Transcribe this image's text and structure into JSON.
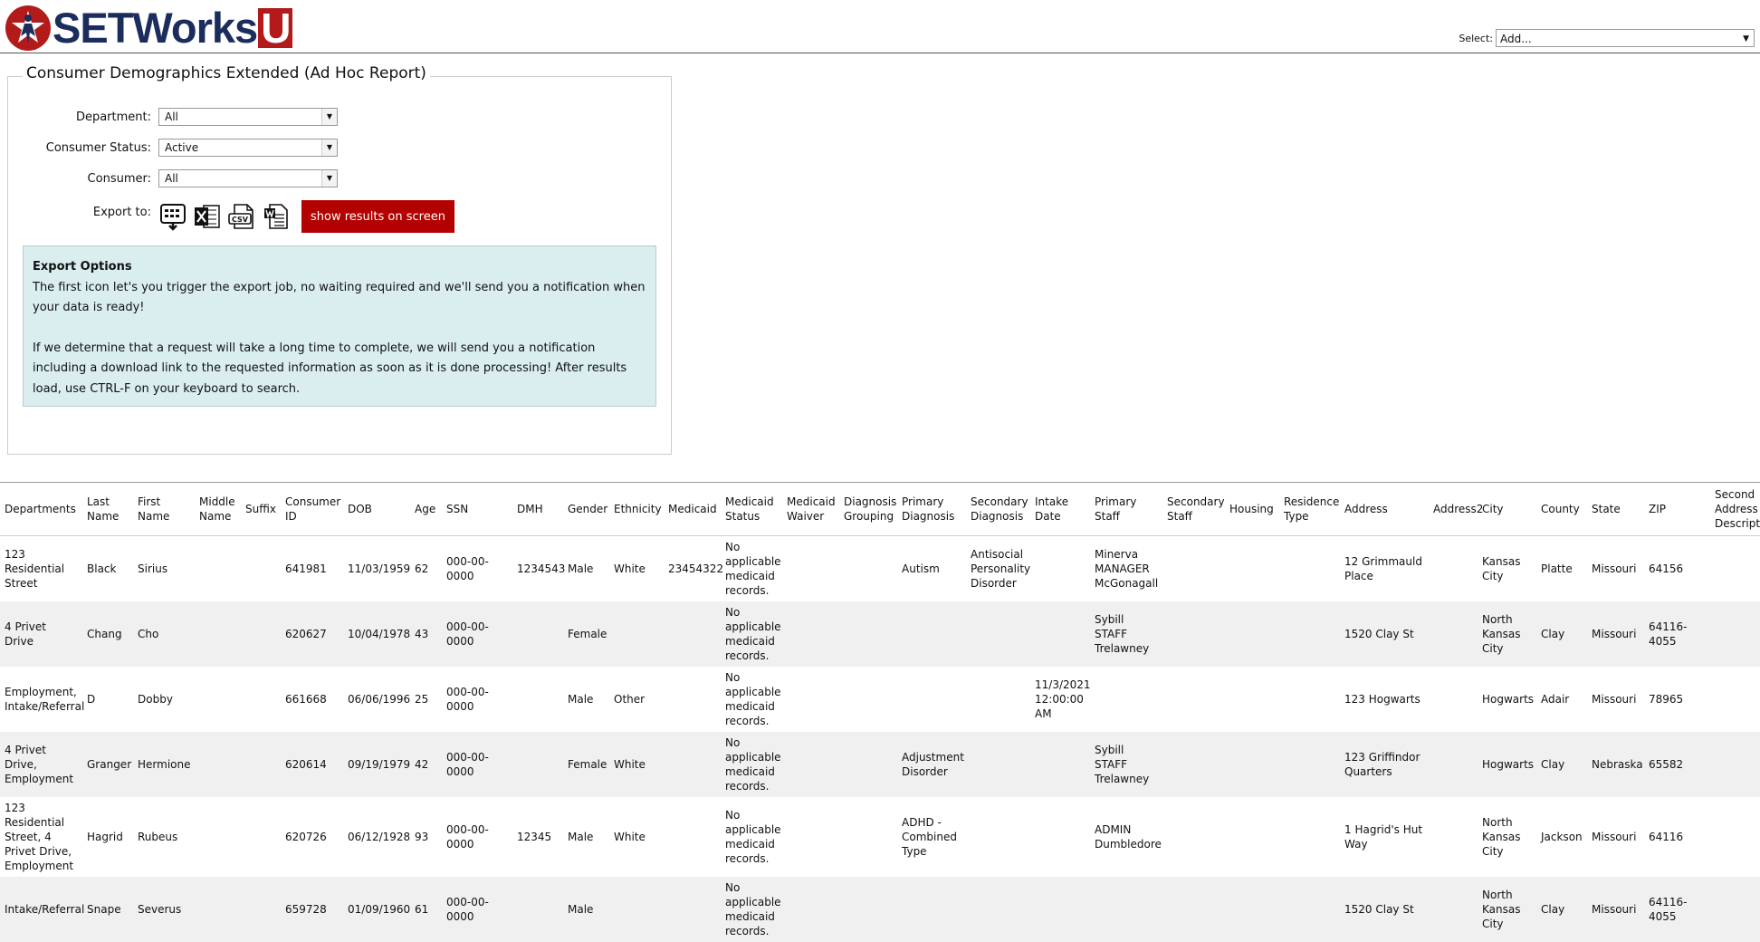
{
  "app": {
    "logo_text": "SETWorks",
    "logo_u": "U"
  },
  "header_select": {
    "label": "Select:",
    "value": "Add..."
  },
  "report": {
    "title": "Consumer Demographics Extended (Ad Hoc Report)",
    "department_label": "Department:",
    "department_value": "All",
    "status_label": "Consumer Status:",
    "status_value": "Active",
    "consumer_label": "Consumer:",
    "consumer_value": "All",
    "export_label": "Export to:",
    "show_button": "show results on screen",
    "icons": [
      "export-job-icon",
      "excel-icon",
      "csv-icon",
      "word-icon"
    ]
  },
  "info": {
    "title": "Export Options",
    "para1": "The first icon let's you trigger the export job, no waiting required and we'll send you a notification when your data is ready!",
    "para2": "If we determine that a request will take a long time to complete, we will send you a notification including a download link to the requested information as soon as it is done processing! After results load, use CTRL-F on your keyboard to search."
  },
  "colors": {
    "brand_red": "#b31b1b",
    "brand_navy": "#1a2d5c",
    "button_red": "#b30000",
    "info_bg": "#daeef0"
  },
  "table": {
    "headers": [
      "Departments",
      "Last Name",
      "First Name",
      "Middle Name",
      "Suffix",
      "Consumer ID",
      "DOB",
      "Age",
      "SSN",
      "DMH",
      "Gender",
      "Ethnicity",
      "Medicaid",
      "Medicaid Status",
      "Medicaid Waiver",
      "Diagnosis Grouping",
      "Primary Diagnosis",
      "Secondary Diagnosis",
      "Intake Date",
      "Primary Staff",
      "Secondary Staff",
      "Housing",
      "Residence Type",
      "Address",
      "Address2",
      "City",
      "County",
      "State",
      "ZIP",
      "Second Address Description"
    ],
    "rows": [
      [
        "123 Residential Street",
        "Black",
        "Sirius",
        "",
        "",
        "641981",
        "11/03/1959",
        "62",
        "000-00-0000",
        "1234543",
        "Male",
        "White",
        "23454322",
        "No applicable medicaid records.",
        "",
        "",
        "Autism",
        "Antisocial Personality Disorder",
        "",
        "Minerva MANAGER McGonagall",
        "",
        "",
        "",
        "12 Grimmauld Place",
        "",
        "Kansas City",
        "Platte",
        "Missouri",
        "64156",
        ""
      ],
      [
        "4 Privet Drive",
        "Chang",
        "Cho",
        "",
        "",
        "620627",
        "10/04/1978",
        "43",
        "000-00-0000",
        "",
        "Female",
        "",
        "",
        "No applicable medicaid records.",
        "",
        "",
        "",
        "",
        "",
        "Sybill STAFF Trelawney",
        "",
        "",
        "",
        "1520 Clay St",
        "",
        "North Kansas City",
        "Clay",
        "Missouri",
        "64116-4055",
        ""
      ],
      [
        "Employment, Intake/Referral",
        "D",
        "Dobby",
        "",
        "",
        "661668",
        "06/06/1996",
        "25",
        "000-00-0000",
        "",
        "Male",
        "Other",
        "",
        "No applicable medicaid records.",
        "",
        "",
        "",
        "",
        "11/3/2021 12:00:00 AM",
        "",
        "",
        "",
        "",
        "123 Hogwarts",
        "",
        "Hogwarts",
        "Adair",
        "Missouri",
        "78965",
        ""
      ],
      [
        "4 Privet Drive, Employment",
        "Granger",
        "Hermione",
        "",
        "",
        "620614",
        "09/19/1979",
        "42",
        "000-00-0000",
        "",
        "Female",
        "White",
        "",
        "No applicable medicaid records.",
        "",
        "",
        "Adjustment Disorder",
        "",
        "",
        "Sybill STAFF Trelawney",
        "",
        "",
        "",
        "123 Griffindor Quarters",
        "",
        "Hogwarts",
        "Clay",
        "Nebraska",
        "65582",
        ""
      ],
      [
        "123 Residential Street, 4 Privet Drive, Employment",
        "Hagrid",
        "Rubeus",
        "",
        "",
        "620726",
        "06/12/1928",
        "93",
        "000-00-0000",
        "12345",
        "Male",
        "White",
        "",
        "No applicable medicaid records.",
        "",
        "",
        "ADHD - Combined Type",
        "",
        "",
        "ADMIN Dumbledore",
        "",
        "",
        "",
        "1 Hagrid's Hut Way",
        "",
        "North Kansas City",
        "Jackson",
        "Missouri",
        "64116",
        ""
      ],
      [
        "Intake/Referral",
        "Snape",
        "Severus",
        "",
        "",
        "659728",
        "01/09/1960",
        "61",
        "000-00-0000",
        "",
        "Male",
        "",
        "",
        "No applicable medicaid records.",
        "",
        "",
        "",
        "",
        "",
        "",
        "",
        "",
        "",
        "1520 Clay St",
        "",
        "North Kansas City",
        "Clay",
        "Missouri",
        "64116-4055",
        ""
      ]
    ]
  }
}
